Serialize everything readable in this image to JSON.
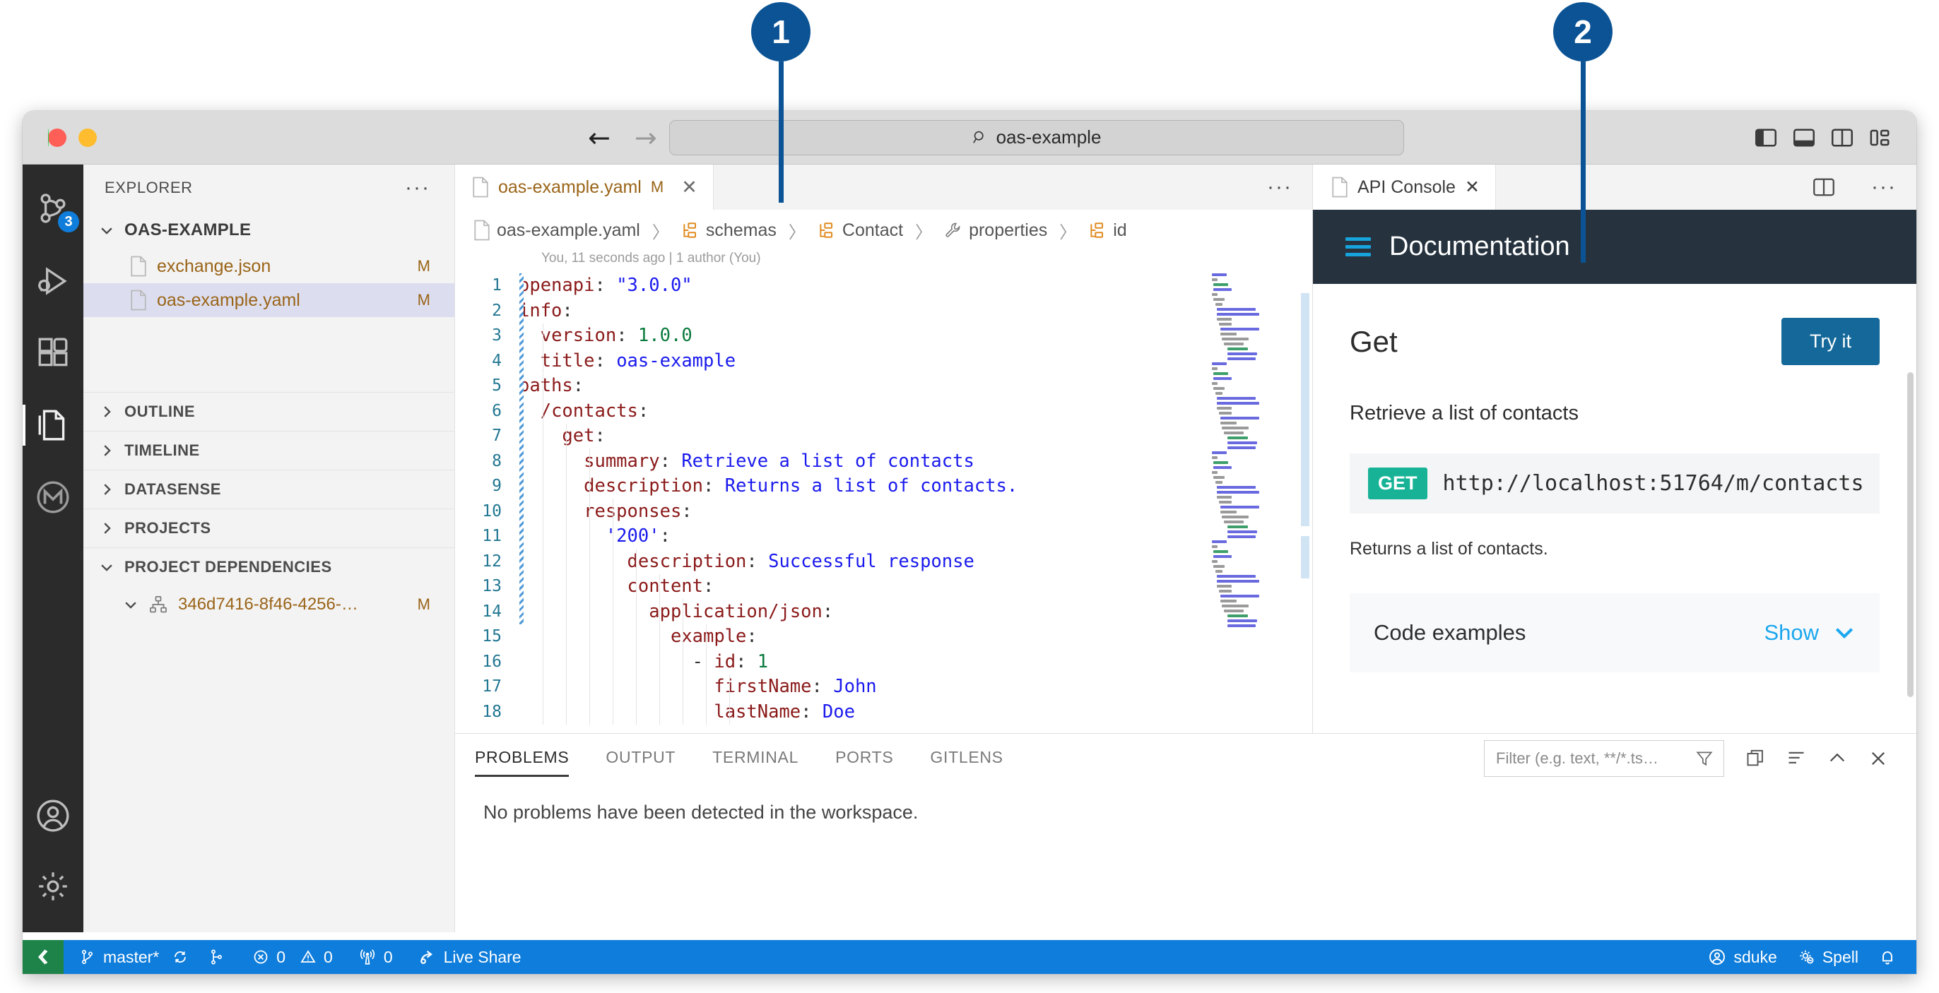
{
  "callouts": [
    {
      "number": "1"
    },
    {
      "number": "2"
    }
  ],
  "titlebar": {
    "back_icon": "arrow-left-icon",
    "forward_icon": "arrow-right-icon",
    "search_icon": "search-icon",
    "search_value": "oas-example",
    "layout_buttons": [
      "toggle-primary-sidebar-icon",
      "toggle-panel-icon",
      "toggle-secondary-sidebar-icon",
      "customize-layout-icon"
    ]
  },
  "activity_bar": {
    "items": [
      {
        "name": "source-control",
        "badge": "3"
      },
      {
        "name": "run-and-debug",
        "badge": ""
      },
      {
        "name": "extensions",
        "badge": ""
      },
      {
        "name": "explorer",
        "badge": ""
      },
      {
        "name": "mulesoft",
        "badge": ""
      }
    ],
    "bottom_items": [
      {
        "name": "accounts"
      },
      {
        "name": "manage-settings"
      }
    ]
  },
  "explorer": {
    "title": "EXPLORER",
    "more_actions": "···",
    "root": "OAS-EXAMPLE",
    "files": [
      {
        "name": "exchange.json",
        "status": "M",
        "selected": false
      },
      {
        "name": "oas-example.yaml",
        "status": "M",
        "selected": true
      }
    ],
    "sections": [
      {
        "label": "OUTLINE",
        "expanded": false
      },
      {
        "label": "TIMELINE",
        "expanded": false
      },
      {
        "label": "DATASENSE",
        "expanded": false
      },
      {
        "label": "PROJECTS",
        "expanded": false
      },
      {
        "label": "PROJECT DEPENDENCIES",
        "expanded": true
      }
    ],
    "dependency": {
      "name": "346d7416-8f46-4256-…",
      "status": "M"
    }
  },
  "editor": {
    "tab": {
      "label": "oas-example.yaml",
      "modified": "M",
      "close": "✕"
    },
    "more_actions": "···",
    "breadcrumb": [
      {
        "label": "oas-example.yaml",
        "icon": "file-icon"
      },
      {
        "label": "schemas",
        "icon": "schema-icon"
      },
      {
        "label": "Contact",
        "icon": "schema-icon"
      },
      {
        "label": "properties",
        "icon": "wrench-icon"
      },
      {
        "label": "id",
        "icon": "schema-icon"
      }
    ],
    "separator": "〉",
    "blame": "You, 11 seconds ago | 1 author (You)",
    "lines": [
      {
        "n": "1",
        "tokens": [
          [
            "k",
            "openapi"
          ],
          [
            "p",
            ": "
          ],
          [
            "s",
            "\"3.0.0\""
          ]
        ]
      },
      {
        "n": "2",
        "tokens": [
          [
            "k",
            "info"
          ],
          [
            "p",
            ":"
          ]
        ]
      },
      {
        "n": "3",
        "tokens": [
          [
            "p",
            "  "
          ],
          [
            "k",
            "version"
          ],
          [
            "p",
            ": "
          ],
          [
            "n",
            "1.0.0"
          ]
        ]
      },
      {
        "n": "4",
        "tokens": [
          [
            "p",
            "  "
          ],
          [
            "k",
            "title"
          ],
          [
            "p",
            ": "
          ],
          [
            "s",
            "oas-example"
          ]
        ]
      },
      {
        "n": "5",
        "tokens": [
          [
            "k",
            "paths"
          ],
          [
            "p",
            ":"
          ]
        ]
      },
      {
        "n": "6",
        "tokens": [
          [
            "p",
            "  "
          ],
          [
            "k",
            "/contacts"
          ],
          [
            "p",
            ":"
          ]
        ]
      },
      {
        "n": "7",
        "tokens": [
          [
            "p",
            "    "
          ],
          [
            "k",
            "get"
          ],
          [
            "p",
            ":"
          ]
        ]
      },
      {
        "n": "8",
        "tokens": [
          [
            "p",
            "      "
          ],
          [
            "k",
            "summary"
          ],
          [
            "p",
            ": "
          ],
          [
            "s",
            "Retrieve a list of contacts"
          ]
        ]
      },
      {
        "n": "9",
        "tokens": [
          [
            "p",
            "      "
          ],
          [
            "k",
            "description"
          ],
          [
            "p",
            ": "
          ],
          [
            "s",
            "Returns a list of contacts."
          ]
        ]
      },
      {
        "n": "10",
        "tokens": [
          [
            "p",
            "      "
          ],
          [
            "k",
            "responses"
          ],
          [
            "p",
            ":"
          ]
        ]
      },
      {
        "n": "11",
        "tokens": [
          [
            "p",
            "        "
          ],
          [
            "s",
            "'200'"
          ],
          [
            "p",
            ":"
          ]
        ]
      },
      {
        "n": "12",
        "tokens": [
          [
            "p",
            "          "
          ],
          [
            "k",
            "description"
          ],
          [
            "p",
            ": "
          ],
          [
            "s",
            "Successful response"
          ]
        ]
      },
      {
        "n": "13",
        "tokens": [
          [
            "p",
            "          "
          ],
          [
            "k",
            "content"
          ],
          [
            "p",
            ":"
          ]
        ]
      },
      {
        "n": "14",
        "tokens": [
          [
            "p",
            "            "
          ],
          [
            "k",
            "application/json"
          ],
          [
            "p",
            ":"
          ]
        ]
      },
      {
        "n": "15",
        "tokens": [
          [
            "p",
            "              "
          ],
          [
            "k",
            "example"
          ],
          [
            "p",
            ":"
          ]
        ]
      },
      {
        "n": "16",
        "tokens": [
          [
            "p",
            "                - "
          ],
          [
            "k",
            "id"
          ],
          [
            "p",
            ": "
          ],
          [
            "n",
            "1"
          ]
        ]
      },
      {
        "n": "17",
        "tokens": [
          [
            "p",
            "                  "
          ],
          [
            "k",
            "firstName"
          ],
          [
            "p",
            ": "
          ],
          [
            "s",
            "John"
          ]
        ]
      },
      {
        "n": "18",
        "tokens": [
          [
            "p",
            "                  "
          ],
          [
            "k",
            "lastName"
          ],
          [
            "p",
            ": "
          ],
          [
            "s",
            "Doe"
          ]
        ]
      }
    ]
  },
  "api_console": {
    "tab": {
      "label": "API Console",
      "close": "✕"
    },
    "split_icon": "split-editor-icon",
    "more_actions": "···",
    "header_title": "Documentation",
    "header_icon": "hamburger-menu-icon",
    "header_bg": "#26333f",
    "accent": "#17a3dc",
    "method_title": "Get",
    "try_it_label": "Try it",
    "try_it_bg": "#14699a",
    "summary": "Retrieve a list of contacts",
    "verb": "GET",
    "verb_bg": "#18b397",
    "url": "http://localhost:51764/m/contacts",
    "description": "Returns a list of contacts.",
    "code_examples_label": "Code examples",
    "show_label": "Show",
    "show_color": "#1ba7ee",
    "chevron_icon": "chevron-down-icon"
  },
  "panel": {
    "tabs": [
      {
        "label": "PROBLEMS",
        "active": true
      },
      {
        "label": "OUTPUT",
        "active": false
      },
      {
        "label": "TERMINAL",
        "active": false
      },
      {
        "label": "PORTS",
        "active": false
      },
      {
        "label": "GITLENS",
        "active": false
      }
    ],
    "filter_placeholder": "Filter (e.g. text, **/*.ts…",
    "filter_icon": "funnel-icon",
    "tools": [
      "copy-icon",
      "collapse-all-icon",
      "chevron-up-icon",
      "close-icon"
    ],
    "message": "No problems have been detected in the workspace."
  },
  "status_bar": {
    "bg": "#0f7ddb",
    "remote_icon": "remote-window-icon",
    "remote_bg": "#1d8348",
    "branch": "master*",
    "sync_icon": "sync-icon",
    "fork_icon": "git-fork-icon",
    "errors": "0",
    "warnings": "0",
    "ports": "0",
    "live_share": "Live Share",
    "account": "sduke",
    "spell": "Spell",
    "bell_icon": "bell-icon"
  }
}
